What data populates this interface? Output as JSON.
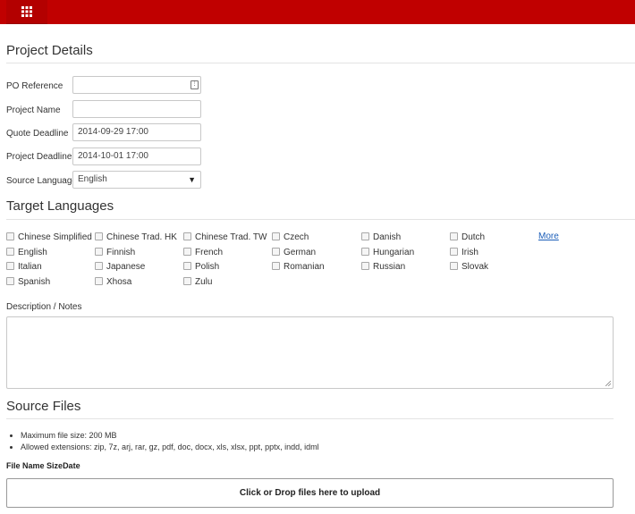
{
  "header": {
    "apps_icon": "grid-icon",
    "brand_color": "#c00000"
  },
  "project_details": {
    "title": "Project Details",
    "po_reference": {
      "label": "PO Reference",
      "value": ""
    },
    "project_name": {
      "label": "Project Name",
      "value": ""
    },
    "quote_deadline": {
      "label": "Quote Deadline",
      "value": "2014-09-29 17:00"
    },
    "project_deadline": {
      "label": "Project Deadline",
      "value": "2014-10-01 17:00"
    },
    "source_language": {
      "label": "Source Language",
      "value": "English"
    }
  },
  "target_languages": {
    "title": "Target Languages",
    "more_label": "More",
    "languages": [
      "Chinese Simplified",
      "Chinese Trad. HK",
      "Chinese Trad. TW",
      "Czech",
      "Danish",
      "Dutch",
      "English",
      "Finnish",
      "French",
      "German",
      "Hungarian",
      "Irish",
      "Italian",
      "Japanese",
      "Polish",
      "Romanian",
      "Russian",
      "Slovak",
      "Spanish",
      "Xhosa",
      "Zulu"
    ]
  },
  "description": {
    "label": "Description / Notes",
    "value": ""
  },
  "source_files": {
    "title": "Source Files",
    "info": [
      "Maximum file size: 200 MB",
      "Allowed extensions: zip, 7z, arj, rar, gz, pdf, doc, docx, xls, xlsx, ppt, pptx, indd, idml"
    ],
    "columns": [
      "File Name",
      "Size",
      "Date"
    ],
    "dropzone_label": "Click or Drop files here to upload"
  }
}
